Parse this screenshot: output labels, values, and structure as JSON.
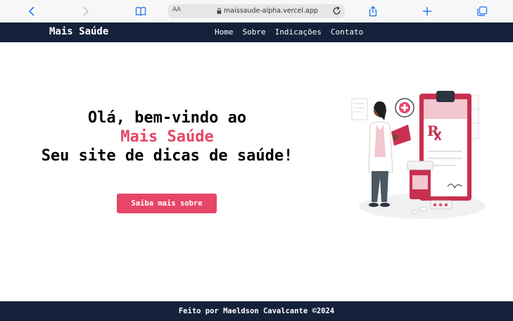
{
  "browser": {
    "url": "maissaude-alpha.vercel.app",
    "reader_label": "AA",
    "accent_color": "#2f7cf6",
    "icons": [
      "chevron-left-icon",
      "chevron-right-icon",
      "book-icon",
      "lock-icon",
      "reload-icon",
      "share-icon",
      "plus-icon",
      "tabs-icon"
    ]
  },
  "nav": {
    "brand": "Mais Saúde",
    "links": [
      "Home",
      "Sobre",
      "Indicações",
      "Contato"
    ],
    "background": "#15213b"
  },
  "hero": {
    "line1": "Olá, bem-vindo ao",
    "line2": "Mais Saúde",
    "line3": "Seu site de dicas de saúde!",
    "button_label": "Saiba mais sobre",
    "accent_color": "#e64668"
  },
  "footer": {
    "text": "Feito por Maeldson Cavalcante ©2024"
  }
}
